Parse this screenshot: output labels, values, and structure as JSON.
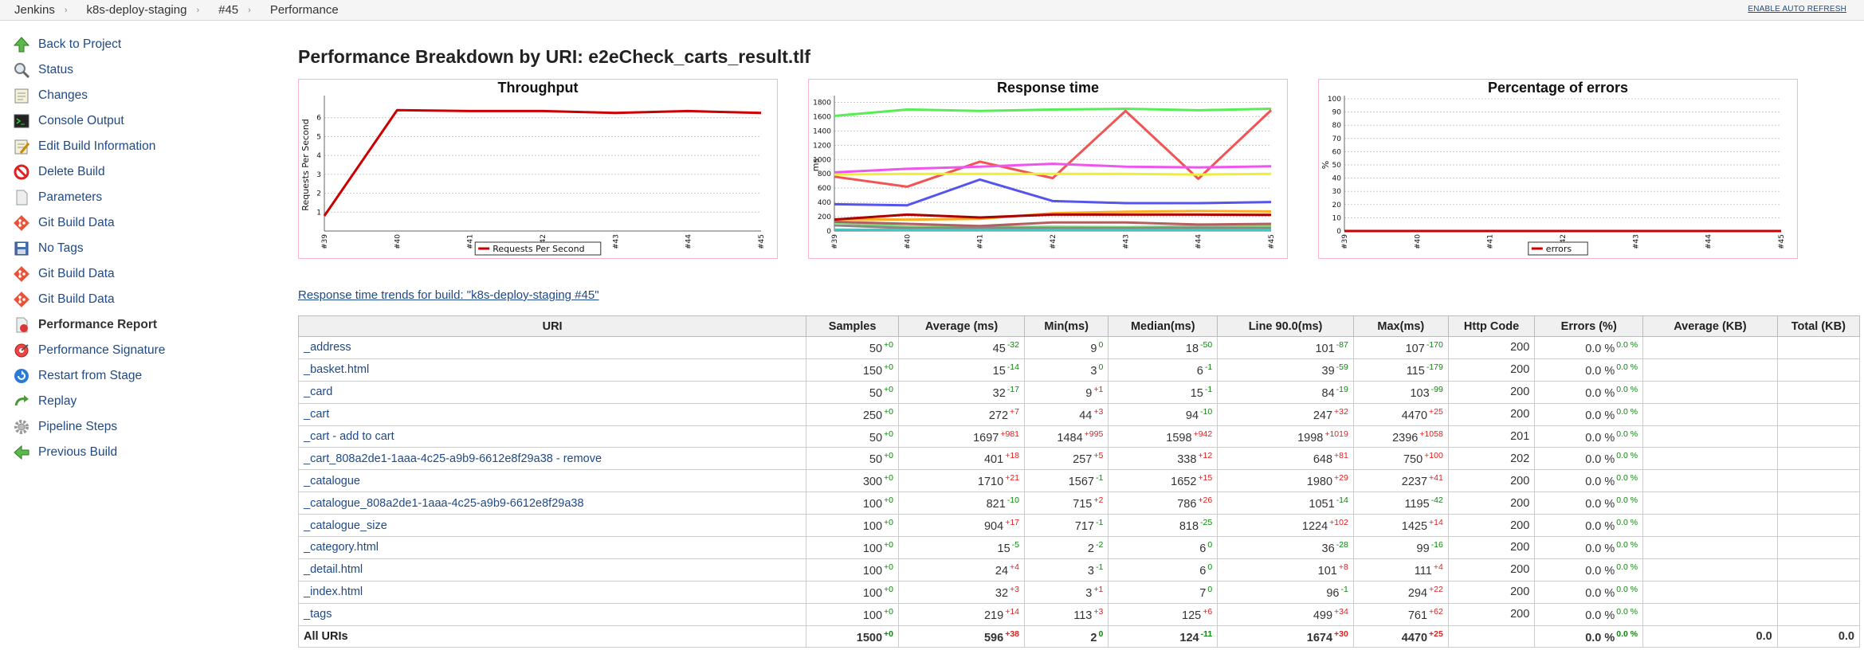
{
  "breadcrumb": [
    "Jenkins",
    "k8s-deploy-staging",
    "#45",
    "Performance"
  ],
  "auto_refresh": "ENABLE AUTO REFRESH",
  "sidebar": [
    {
      "label": "Back to Project",
      "icon": "up-arrow-icon"
    },
    {
      "label": "Status",
      "icon": "magnifier-icon"
    },
    {
      "label": "Changes",
      "icon": "notepad-icon"
    },
    {
      "label": "Console Output",
      "icon": "terminal-icon"
    },
    {
      "label": "Edit Build Information",
      "icon": "edit-notepad-icon"
    },
    {
      "label": "Delete Build",
      "icon": "no-entry-icon"
    },
    {
      "label": "Parameters",
      "icon": "document-icon"
    },
    {
      "label": "Git Build Data",
      "icon": "git-icon"
    },
    {
      "label": "No Tags",
      "icon": "save-icon"
    },
    {
      "label": "Git Build Data",
      "icon": "git-icon"
    },
    {
      "label": "Git Build Data",
      "icon": "git-icon"
    },
    {
      "label": "Performance Report",
      "icon": "report-icon",
      "active": true
    },
    {
      "label": "Performance Signature",
      "icon": "signature-icon"
    },
    {
      "label": "Restart from Stage",
      "icon": "restart-icon"
    },
    {
      "label": "Replay",
      "icon": "replay-icon"
    },
    {
      "label": "Pipeline Steps",
      "icon": "gear-icon"
    },
    {
      "label": "Previous Build",
      "icon": "left-arrow-icon"
    }
  ],
  "page_title": "Performance Breakdown by URI: e2eCheck_carts_result.tlf",
  "trend_link": "Response time trends for build: \"k8s-deploy-staging #45\"",
  "colors": {
    "accent_red": "#cc0000",
    "link": "#204a87",
    "chart_border": "#f2b8c6"
  },
  "chart_data": [
    {
      "type": "line",
      "title": "Throughput",
      "ylabel": "Requests Per Second",
      "x": [
        "#39",
        "#40",
        "#41",
        "#42",
        "#43",
        "#44",
        "#45"
      ],
      "ylim": [
        0,
        7
      ],
      "yticks": [
        1,
        2,
        3,
        4,
        5,
        6
      ],
      "series": [
        {
          "name": "Requests Per Second",
          "color": "#cc0000",
          "values": [
            0.8,
            6.4,
            6.35,
            6.35,
            6.25,
            6.35,
            6.25
          ]
        }
      ],
      "legend": "bottom"
    },
    {
      "type": "line",
      "title": "Response time",
      "ylabel": "ms",
      "x": [
        "#39",
        "#40",
        "#41",
        "#42",
        "#43",
        "#44",
        "#45"
      ],
      "ylim": [
        0,
        1850
      ],
      "yticks": [
        0,
        200,
        400,
        600,
        800,
        1000,
        1200,
        1400,
        1600,
        1800
      ],
      "series": [
        {
          "color": "#55ee55",
          "values": [
            1610,
            1700,
            1680,
            1700,
            1710,
            1690,
            1710
          ]
        },
        {
          "color": "#f05555",
          "values": [
            760,
            620,
            970,
            740,
            1680,
            730,
            1690
          ]
        },
        {
          "color": "#ee55ee",
          "values": [
            820,
            870,
            900,
            940,
            900,
            890,
            905
          ]
        },
        {
          "color": "#eeee33",
          "values": [
            790,
            800,
            800,
            800,
            800,
            790,
            800
          ]
        },
        {
          "color": "#5555ee",
          "values": [
            375,
            360,
            720,
            420,
            390,
            390,
            405
          ]
        },
        {
          "color": "#ffaa22",
          "values": [
            165,
            160,
            170,
            250,
            270,
            280,
            275
          ]
        },
        {
          "color": "#aa0000",
          "values": [
            160,
            230,
            190,
            230,
            230,
            230,
            225
          ]
        },
        {
          "color": "#77dd77",
          "values": [
            120,
            60,
            55,
            60,
            55,
            65,
            70
          ]
        },
        {
          "color": "#b06060",
          "values": [
            130,
            100,
            70,
            120,
            120,
            90,
            100
          ]
        },
        {
          "color": "#888888",
          "values": [
            80,
            40,
            45,
            40,
            40,
            45,
            40
          ]
        },
        {
          "color": "#33cccc",
          "values": [
            20,
            15,
            15,
            15,
            15,
            15,
            15
          ]
        }
      ]
    },
    {
      "type": "line",
      "title": "Percentage of errors",
      "ylabel": "%",
      "x": [
        "#39",
        "#40",
        "#41",
        "#42",
        "#43",
        "#44",
        "#45"
      ],
      "ylim": [
        0,
        100
      ],
      "yticks": [
        0,
        10,
        20,
        30,
        40,
        50,
        60,
        70,
        80,
        90,
        100
      ],
      "series": [
        {
          "name": "errors",
          "color": "#cc0000",
          "values": [
            0,
            0,
            0,
            0,
            0,
            0,
            0
          ]
        }
      ],
      "legend": "bottom"
    }
  ],
  "table": {
    "headers": [
      "URI",
      "Samples",
      "Average (ms)",
      "Min(ms)",
      "Median(ms)",
      "Line 90.0(ms)",
      "Max(ms)",
      "Http Code",
      "Errors (%)",
      "Average (KB)",
      "Total (KB)"
    ],
    "rows": [
      {
        "uri": "_address",
        "samples": [
          "50",
          "+0"
        ],
        "avg": [
          "45",
          "-32"
        ],
        "min": [
          "9",
          "0"
        ],
        "median": [
          "18",
          "-50"
        ],
        "line90": [
          "101",
          "-87"
        ],
        "max": [
          "107",
          "-170"
        ],
        "http": "200",
        "errors": [
          "0.0 %",
          "0.0 %"
        ]
      },
      {
        "uri": "_basket.html",
        "samples": [
          "150",
          "+0"
        ],
        "avg": [
          "15",
          "-14"
        ],
        "min": [
          "3",
          "0"
        ],
        "median": [
          "6",
          "-1"
        ],
        "line90": [
          "39",
          "-59"
        ],
        "max": [
          "115",
          "-179"
        ],
        "http": "200",
        "errors": [
          "0.0 %",
          "0.0 %"
        ]
      },
      {
        "uri": "_card",
        "samples": [
          "50",
          "+0"
        ],
        "avg": [
          "32",
          "-17"
        ],
        "min": [
          "9",
          "+1"
        ],
        "median": [
          "15",
          "-1"
        ],
        "line90": [
          "84",
          "-19"
        ],
        "max": [
          "103",
          "-99"
        ],
        "http": "200",
        "errors": [
          "0.0 %",
          "0.0 %"
        ]
      },
      {
        "uri": "_cart",
        "samples": [
          "250",
          "+0"
        ],
        "avg": [
          "272",
          "+7"
        ],
        "min": [
          "44",
          "+3"
        ],
        "median": [
          "94",
          "-10"
        ],
        "line90": [
          "247",
          "+32"
        ],
        "max": [
          "4470",
          "+25"
        ],
        "http": "200",
        "errors": [
          "0.0 %",
          "0.0 %"
        ]
      },
      {
        "uri": "_cart - add to cart",
        "samples": [
          "50",
          "+0"
        ],
        "avg": [
          "1697",
          "+981"
        ],
        "min": [
          "1484",
          "+995"
        ],
        "median": [
          "1598",
          "+942"
        ],
        "line90": [
          "1998",
          "+1019"
        ],
        "max": [
          "2396",
          "+1058"
        ],
        "http": "201",
        "errors": [
          "0.0 %",
          "0.0 %"
        ]
      },
      {
        "uri": "_cart_808a2de1-1aaa-4c25-a9b9-6612e8f29a38 - remove",
        "samples": [
          "50",
          "+0"
        ],
        "avg": [
          "401",
          "+18"
        ],
        "min": [
          "257",
          "+5"
        ],
        "median": [
          "338",
          "+12"
        ],
        "line90": [
          "648",
          "+81"
        ],
        "max": [
          "750",
          "+100"
        ],
        "http": "202",
        "errors": [
          "0.0 %",
          "0.0 %"
        ]
      },
      {
        "uri": "_catalogue",
        "samples": [
          "300",
          "+0"
        ],
        "avg": [
          "1710",
          "+21"
        ],
        "min": [
          "1567",
          "-1"
        ],
        "median": [
          "1652",
          "+15"
        ],
        "line90": [
          "1980",
          "+29"
        ],
        "max": [
          "2237",
          "+41"
        ],
        "http": "200",
        "errors": [
          "0.0 %",
          "0.0 %"
        ]
      },
      {
        "uri": "_catalogue_808a2de1-1aaa-4c25-a9b9-6612e8f29a38",
        "samples": [
          "100",
          "+0"
        ],
        "avg": [
          "821",
          "-10"
        ],
        "min": [
          "715",
          "+2"
        ],
        "median": [
          "786",
          "+26"
        ],
        "line90": [
          "1051",
          "-14"
        ],
        "max": [
          "1195",
          "-42"
        ],
        "http": "200",
        "errors": [
          "0.0 %",
          "0.0 %"
        ]
      },
      {
        "uri": "_catalogue_size",
        "samples": [
          "100",
          "+0"
        ],
        "avg": [
          "904",
          "+17"
        ],
        "min": [
          "717",
          "-1"
        ],
        "median": [
          "818",
          "-25"
        ],
        "line90": [
          "1224",
          "+102"
        ],
        "max": [
          "1425",
          "+14"
        ],
        "http": "200",
        "errors": [
          "0.0 %",
          "0.0 %"
        ]
      },
      {
        "uri": "_category.html",
        "samples": [
          "100",
          "+0"
        ],
        "avg": [
          "15",
          "-5"
        ],
        "min": [
          "2",
          "-2"
        ],
        "median": [
          "6",
          "0"
        ],
        "line90": [
          "36",
          "-28"
        ],
        "max": [
          "99",
          "-16"
        ],
        "http": "200",
        "errors": [
          "0.0 %",
          "0.0 %"
        ]
      },
      {
        "uri": "_detail.html",
        "samples": [
          "100",
          "+0"
        ],
        "avg": [
          "24",
          "+4"
        ],
        "min": [
          "3",
          "-1"
        ],
        "median": [
          "6",
          "0"
        ],
        "line90": [
          "101",
          "+8"
        ],
        "max": [
          "111",
          "+4"
        ],
        "http": "200",
        "errors": [
          "0.0 %",
          "0.0 %"
        ]
      },
      {
        "uri": "_index.html",
        "samples": [
          "100",
          "+0"
        ],
        "avg": [
          "32",
          "+3"
        ],
        "min": [
          "3",
          "+1"
        ],
        "median": [
          "7",
          "0"
        ],
        "line90": [
          "96",
          "-1"
        ],
        "max": [
          "294",
          "+22"
        ],
        "http": "200",
        "errors": [
          "0.0 %",
          "0.0 %"
        ]
      },
      {
        "uri": "_tags",
        "samples": [
          "100",
          "+0"
        ],
        "avg": [
          "219",
          "+14"
        ],
        "min": [
          "113",
          "+3"
        ],
        "median": [
          "125",
          "+6"
        ],
        "line90": [
          "499",
          "+34"
        ],
        "max": [
          "761",
          "+62"
        ],
        "http": "200",
        "errors": [
          "0.0 %",
          "0.0 %"
        ]
      }
    ],
    "total": {
      "uri": "All URIs",
      "samples": [
        "1500",
        "+0"
      ],
      "avg": [
        "596",
        "+38"
      ],
      "min": [
        "2",
        "0"
      ],
      "median": [
        "124",
        "-11"
      ],
      "line90": [
        "1674",
        "+30"
      ],
      "max": [
        "4470",
        "+25"
      ],
      "http": "",
      "errors": [
        "0.0 %",
        "0.0 %"
      ],
      "avg_kb": "0.0",
      "total_kb": "0.0"
    }
  }
}
